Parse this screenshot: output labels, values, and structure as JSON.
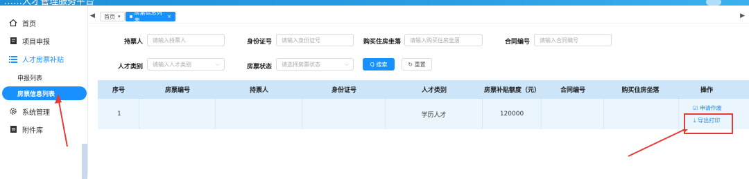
{
  "header": {
    "title": "……人才管理服务平台"
  },
  "sidebar": {
    "items": [
      {
        "label": "首页",
        "icon": "home-icon"
      },
      {
        "label": "项目申报",
        "icon": "document-icon"
      },
      {
        "label": "人才房票补贴",
        "icon": "list-icon"
      },
      {
        "label": "系统管理",
        "icon": "gear-icon"
      },
      {
        "label": "附件库",
        "icon": "file-icon"
      }
    ],
    "sub_items": [
      {
        "label": "申报列表"
      },
      {
        "label": "房票信息列表"
      }
    ]
  },
  "tabs": {
    "prev": "◀",
    "next": "▶",
    "home": "首页",
    "home_arrow": "▾",
    "current": "房票信息列表",
    "close": "×"
  },
  "filters": {
    "holder": {
      "label": "持票人",
      "placeholder": "请输入持票人"
    },
    "id_card": {
      "label": "身份证号",
      "placeholder": "请输入身份证号"
    },
    "house": {
      "label": "购买住房坐落",
      "placeholder": "请输入购买住房坐落"
    },
    "contract": {
      "label": "合同编号",
      "placeholder": "请输入合同编号"
    },
    "talent_type": {
      "label": "人才类别",
      "placeholder": "请输入人才类别"
    },
    "status": {
      "label": "房票状态",
      "placeholder": "请选择房票状态"
    },
    "search_btn": "Q 搜索",
    "reset_btn": "↻ 重置"
  },
  "table": {
    "columns": [
      "序号",
      "房票编号",
      "持票人",
      "身份证号",
      "人才类别",
      "房票补贴额度（元）",
      "合同编号",
      "购买住房坐落",
      "操作"
    ],
    "rows": [
      {
        "index": "1",
        "ticket_no": "",
        "holder": "",
        "id_card": "",
        "talent_type": "学历人才",
        "amount": "120000",
        "contract": "",
        "house": "",
        "actions": {
          "void": "☑ 申请作废",
          "export": "⤓ 导出打印"
        }
      }
    ]
  },
  "colors": {
    "accent": "#1890ff",
    "header_row": "#cce5f8",
    "row": "#eaf5fd",
    "annotation": "#e53935"
  }
}
